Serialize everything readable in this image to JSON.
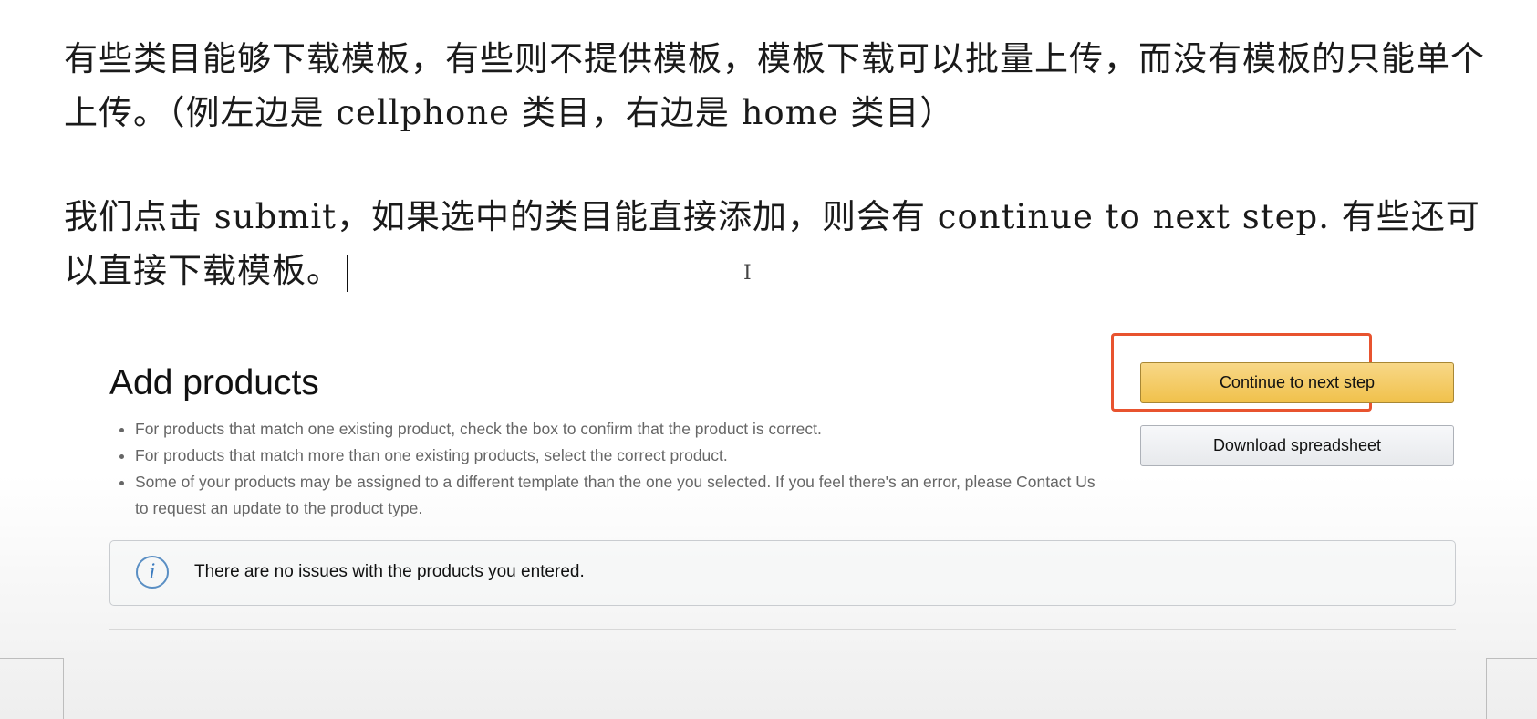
{
  "document": {
    "paragraph1": "有些类目能够下载模板，有些则不提供模板，模板下载可以批量上传，而没有模板的只能单个上传。（例左边是 cellphone 类目，右边是 home 类目）",
    "paragraph2": "我们点击 submit，如果选中的类目能直接添加，则会有 continue to next step. 有些还可以直接下载模板。",
    "ibeam_glyph": "I"
  },
  "embedded_screenshot": {
    "title": "Add products",
    "bullets": [
      "For products that match one existing product, check the box to confirm that the product is correct.",
      "For products that match more than one existing products, select the correct product.",
      "Some of your products may be assigned to a different template than the one you selected. If you feel there's an error, please Contact Us to request an update to the product type."
    ],
    "primary_button": "Continue to next step",
    "secondary_button": "Download spreadsheet",
    "alert_icon": "i",
    "alert_text": "There are no issues with the products you entered.",
    "highlight_color": "#e8532f",
    "primary_button_color": "#f0c14b"
  }
}
